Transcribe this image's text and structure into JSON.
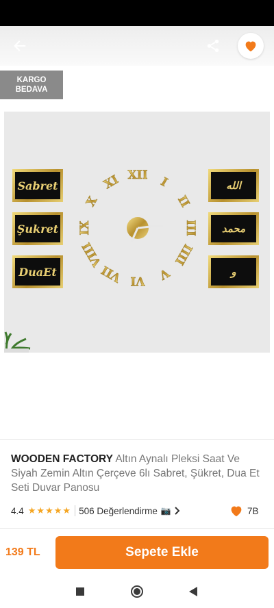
{
  "header": {
    "back_icon": "arrow-left-icon",
    "share_icon": "share-icon",
    "favorite_icon": "heart-icon",
    "favorite_color": "#f27a1a"
  },
  "badge": {
    "line1": "KARGO",
    "line2": "BEDAVA"
  },
  "image": {
    "plaques_left": [
      "Sabret",
      "Şukret",
      "DuaEt"
    ],
    "plaques_right": [
      "الله",
      "محمد",
      "و"
    ],
    "clock_numerals": [
      "XII",
      "I",
      "II",
      "III",
      "IIII",
      "V",
      "VI",
      "VII",
      "VIII",
      "IX",
      "X",
      "XI"
    ]
  },
  "product": {
    "brand": "WOODEN FACTORY",
    "name": " Altın Aynalı Pleksi Saat Ve Siyah Zemin Altın Çerçeve 6lı Sabret, Şükret, Dua Et Seti Duvar Panosu",
    "rating": "4.4",
    "stars": "★★★★★",
    "review_count": "506 Değerlendirme",
    "camera_icon": "camera-icon",
    "chevron_icon": "chevron-right-icon",
    "favorite_count": "7B"
  },
  "footer": {
    "price": "139 TL",
    "cart_label": "Sepete Ekle",
    "accent": "#f27a1a"
  },
  "nav": {
    "recents_icon": "square-icon",
    "home_icon": "circle-icon",
    "back_icon": "triangle-back-icon"
  }
}
